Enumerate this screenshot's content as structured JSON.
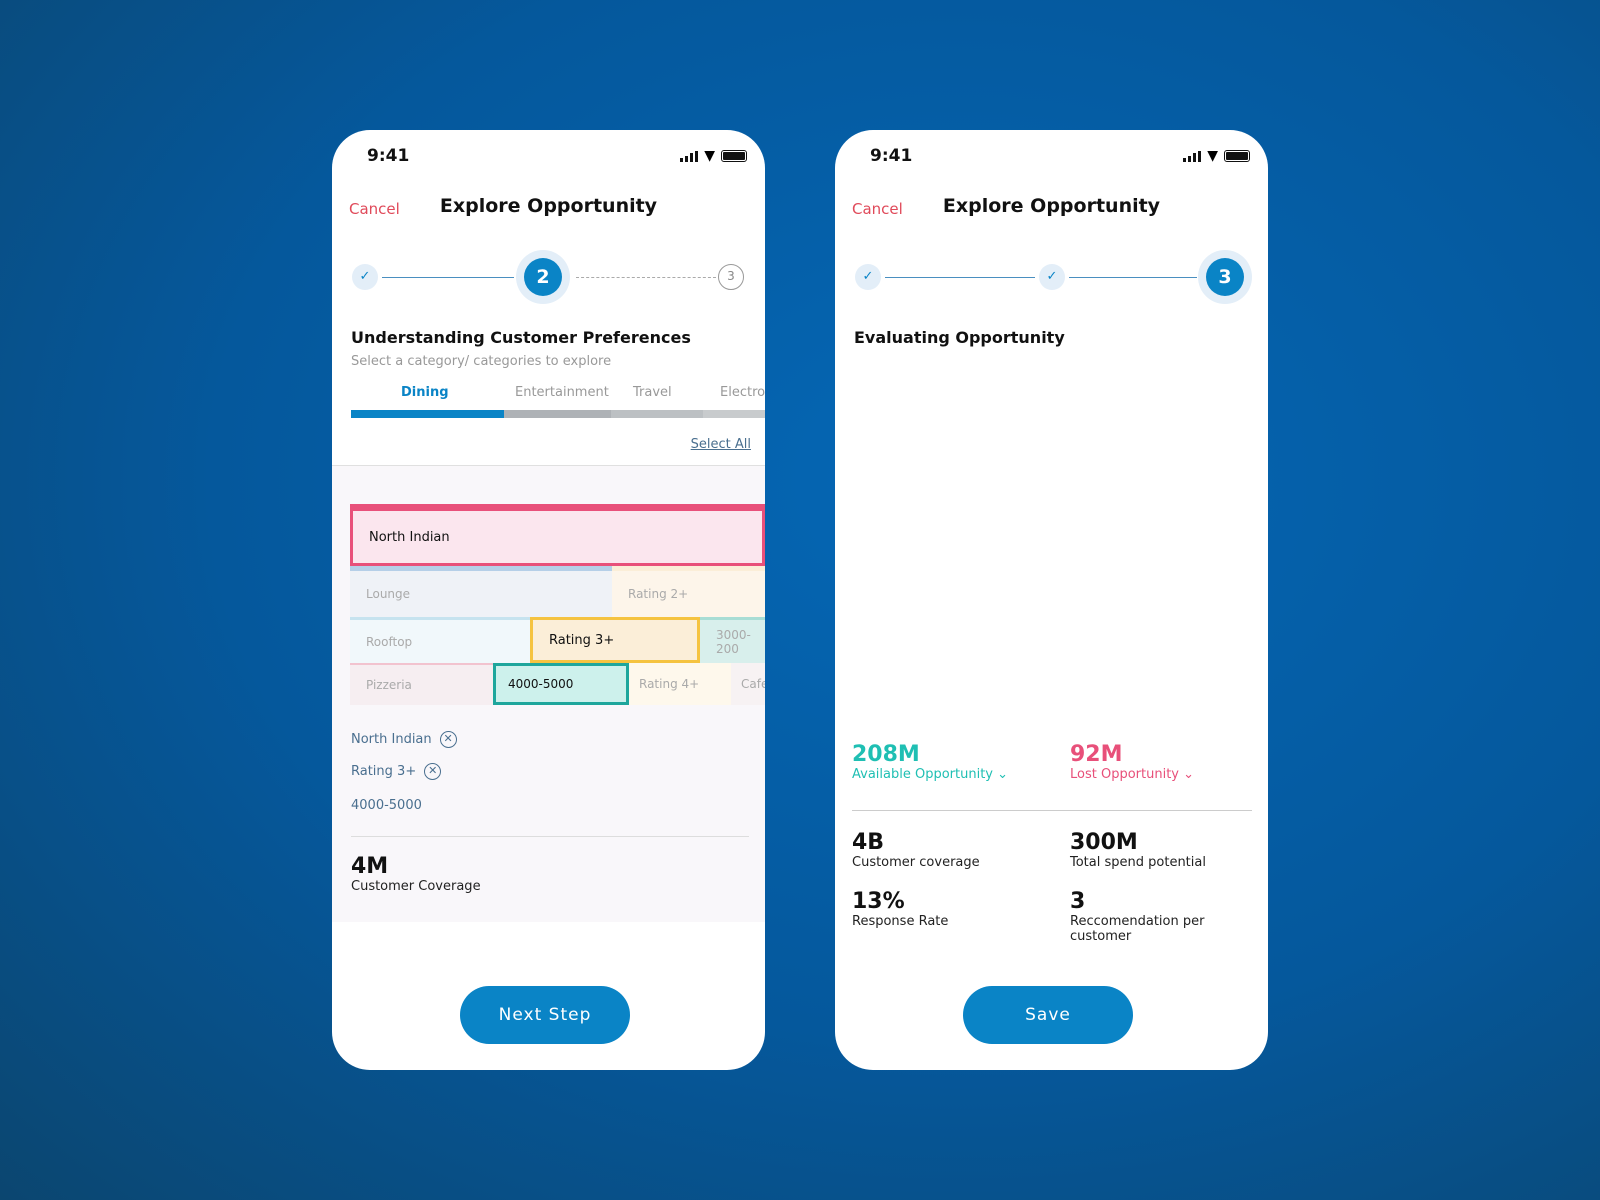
{
  "status": {
    "time": "9:41"
  },
  "screen1": {
    "cancel": "Cancel",
    "title": "Explore Opportunity",
    "steps": {
      "current": "2",
      "next": "3"
    },
    "heading": "Understanding Customer Preferences",
    "subheading": "Select a category/ categories to explore",
    "tabs": [
      "Dining",
      "Entertainment",
      "Travel",
      "Electro"
    ],
    "select_all": "Select All",
    "cells": {
      "north_indian": "North Indian",
      "lounge": "Lounge",
      "rating2": "Rating 2+",
      "rooftop": "Rooftop",
      "rating3": "Rating 3+",
      "range3000": "3000-200",
      "pizzeria": "Pizzeria",
      "range4000": "4000-5000",
      "rating4": "Rating 4+",
      "cafe": "Cafe"
    },
    "chips": [
      "North Indian",
      "Rating 3+",
      "4000-5000"
    ],
    "coverage_value": "4M",
    "coverage_label": "Customer Coverage",
    "next": "Next Step"
  },
  "screen2": {
    "cancel": "Cancel",
    "title": "Explore Opportunity",
    "steps": {
      "current": "3"
    },
    "heading": "Evaluating Opportunity",
    "available": {
      "value": "208M",
      "label": "Available Opportunity",
      "color": "#1fbfb3"
    },
    "lost": {
      "value": "92M",
      "label": "Lost Opportunity",
      "color": "#e8507a"
    },
    "metrics": [
      {
        "value": "4B",
        "label": "Customer coverage"
      },
      {
        "value": "300M",
        "label": "Total spend potential"
      },
      {
        "value": "13%",
        "label": "Response Rate"
      },
      {
        "value": "3",
        "label": "Reccomendation per customer"
      }
    ],
    "save": "Save"
  }
}
